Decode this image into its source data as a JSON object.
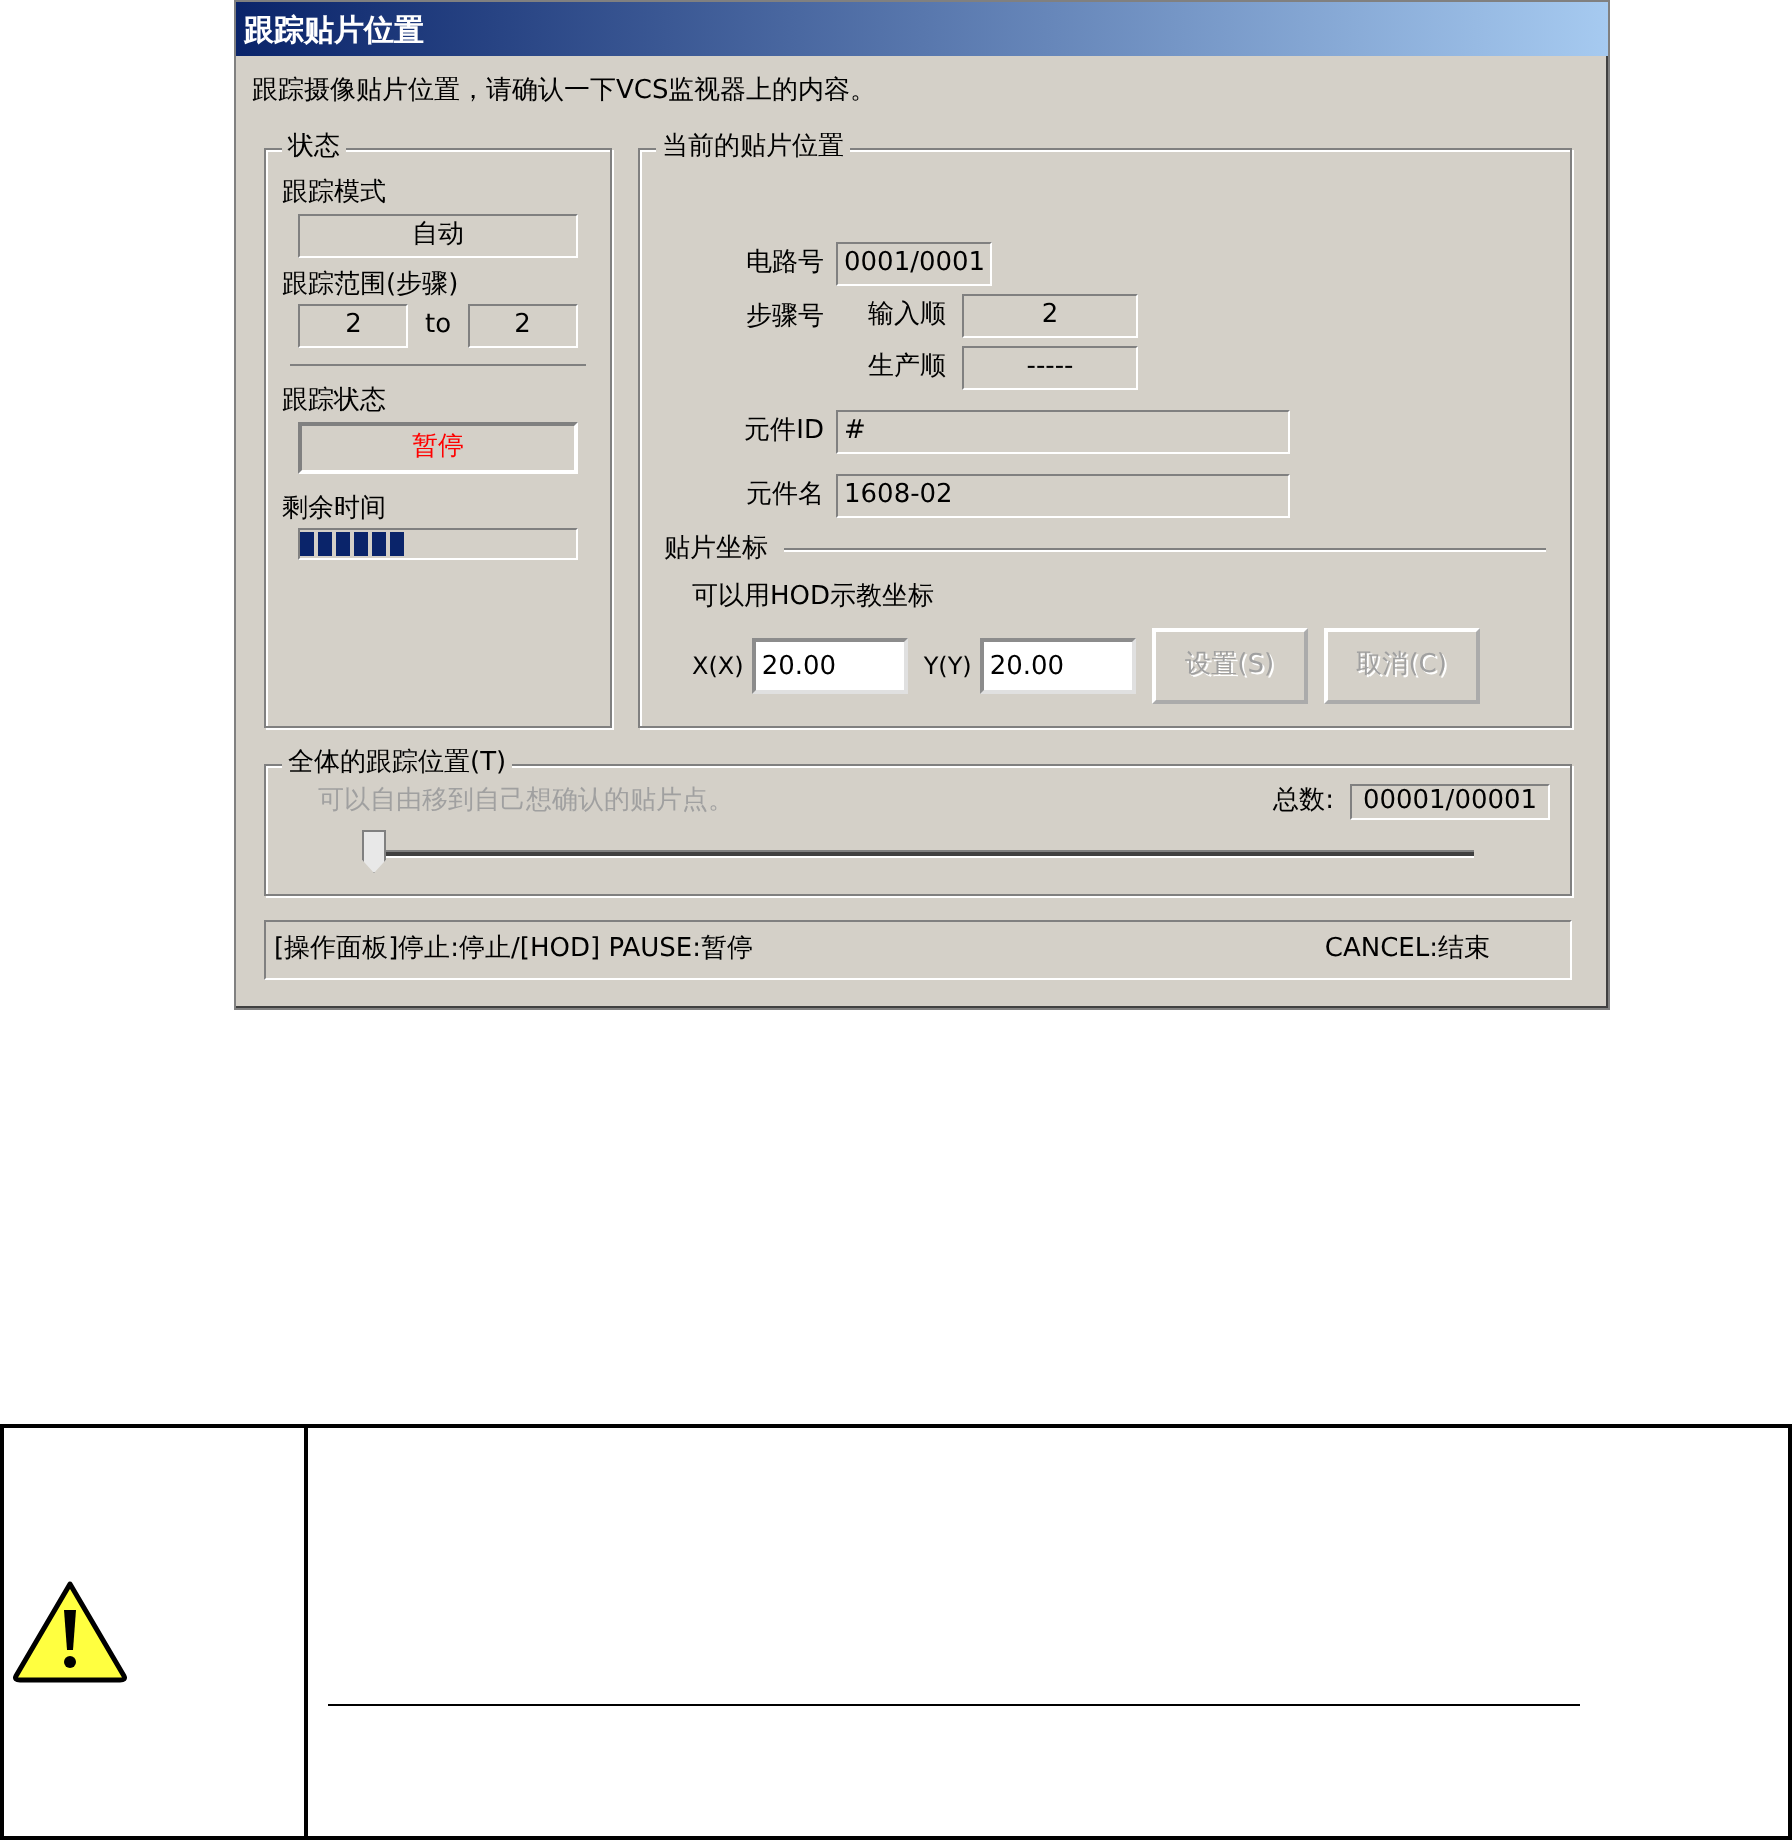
{
  "window": {
    "title": "跟踪贴片位置"
  },
  "instruction": "跟踪摄像贴片位置，请确认一下VCS监视器上的内容。",
  "status_group": {
    "title": "状态",
    "mode_label": "跟踪模式",
    "mode_value": "自动",
    "range_label": "跟踪范围(步骤)",
    "range_from": "2",
    "range_to_word": "to",
    "range_to": "2",
    "state_label": "跟踪状态",
    "state_value": "暂停",
    "remaining_label": "剩余时间",
    "remaining": {
      "level": 0.38
    }
  },
  "position_group": {
    "title": "当前的贴片位置",
    "circuit_label": "电路号",
    "circuit_value": "0001/0001",
    "step_label": "步骤号",
    "input_label": "输入顺",
    "input_value": "2",
    "production_label": "生产顺",
    "production_value": "-----",
    "part_id_label": "元件ID",
    "part_id_value": "#",
    "part_name_label": "元件名",
    "part_name_value": "1608-02",
    "coords_title": "贴片坐标",
    "coords_hint": "可以用HOD示教坐标",
    "x_label": "X(X)",
    "x_value": "20.00",
    "y_label": "Y(Y)",
    "y_value": "20.00",
    "buttons": [
      {
        "label": "设置(S)",
        "disabled": true
      },
      {
        "label": "取消(C)",
        "disabled": true
      }
    ]
  },
  "overall_group": {
    "title": "全体的跟踪位置(T)",
    "hint": "可以自由移到自己想确认的贴片点。",
    "hint_disabled": true,
    "total_label": "总数:",
    "total_value": "00001/00001",
    "slider": {
      "level": 0
    }
  },
  "status_bar": {
    "left": "[操作面板]停止:停止/[HOD] PAUSE:暂停",
    "right": "CANCEL:结束"
  }
}
